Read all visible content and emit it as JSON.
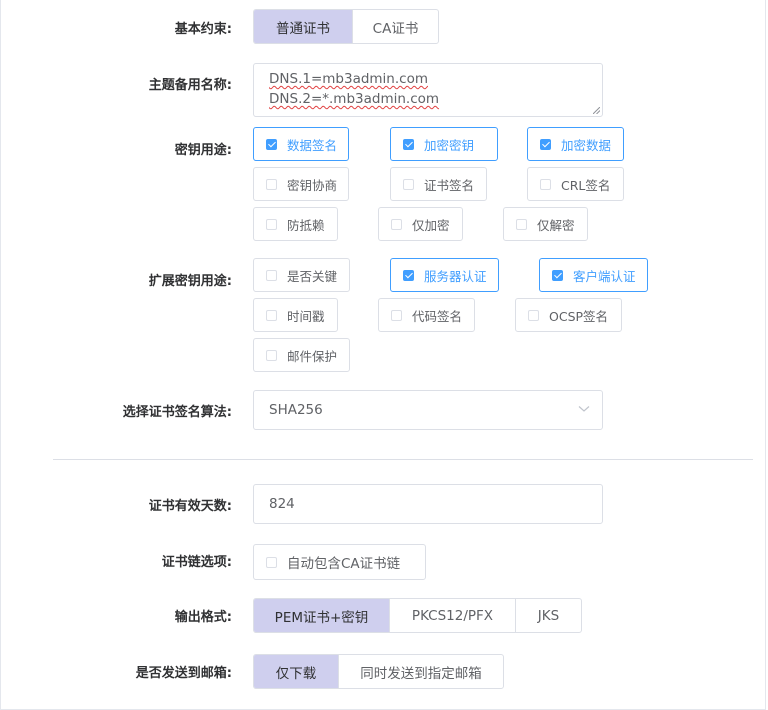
{
  "basic_constraint": {
    "label": "基本约束:",
    "options": [
      "普通证书",
      "CA证书"
    ],
    "selected": "普通证书"
  },
  "san": {
    "label": "主题备用名称:",
    "lines": [
      "DNS.1=mb3admin.com",
      "DNS.2=*.mb3admin.com"
    ]
  },
  "key_usage": {
    "label": "密钥用途:",
    "items": [
      {
        "label": "数据签名",
        "checked": true
      },
      {
        "label": "加密密钥",
        "checked": true
      },
      {
        "label": "加密数据",
        "checked": true
      },
      {
        "label": "密钥协商",
        "checked": false
      },
      {
        "label": "证书签名",
        "checked": false
      },
      {
        "label": "CRL签名",
        "checked": false
      },
      {
        "label": "防抵赖",
        "checked": false
      },
      {
        "label": "仅加密",
        "checked": false
      },
      {
        "label": "仅解密",
        "checked": false
      }
    ]
  },
  "ext_key_usage": {
    "label": "扩展密钥用途:",
    "items": [
      {
        "label": "是否关键",
        "checked": false
      },
      {
        "label": "服务器认证",
        "checked": true
      },
      {
        "label": "客户端认证",
        "checked": true
      },
      {
        "label": "时间戳",
        "checked": false
      },
      {
        "label": "代码签名",
        "checked": false
      },
      {
        "label": "OCSP签名",
        "checked": false
      },
      {
        "label": "邮件保护",
        "checked": false
      }
    ]
  },
  "algorithm": {
    "label": "选择证书签名算法:",
    "value": "SHA256"
  },
  "validity": {
    "label": "证书有效天数:",
    "value": "824"
  },
  "chain": {
    "label": "证书链选项:",
    "checkbox_label": "自动包含CA证书链",
    "checked": false
  },
  "output_format": {
    "label": "输出格式:",
    "options": [
      "PEM证书+密钥",
      "PKCS12/PFX",
      "JKS"
    ],
    "selected": "PEM证书+密钥"
  },
  "send_email": {
    "label": "是否发送到邮箱:",
    "options": [
      "仅下载",
      "同时发送到指定邮箱"
    ],
    "selected": "仅下载"
  },
  "colors": {
    "accent": "#409eff",
    "selected_bg": "#cfcfee",
    "border": "#dcdfe6"
  }
}
